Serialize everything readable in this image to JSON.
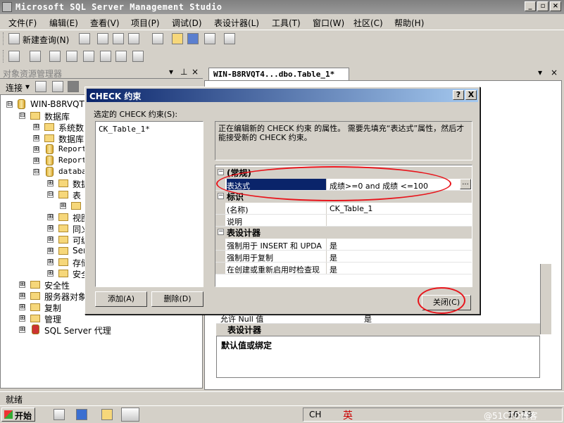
{
  "app": {
    "title": "Microsoft SQL Server Management Studio"
  },
  "menu": [
    "文件(F)",
    "编辑(E)",
    "查看(V)",
    "项目(P)",
    "调试(D)",
    "表设计器(L)",
    "工具(T)",
    "窗口(W)",
    "社区(C)",
    "帮助(H)"
  ],
  "toolbar": {
    "new_query": "新建查询(N)"
  },
  "object_explorer": {
    "title": "对象资源管理器",
    "connect": "连接",
    "tree": [
      {
        "label": "WIN-B8RVQT412",
        "toggle": "⊟"
      },
      {
        "label": "数据库",
        "toggle": "⊟"
      },
      {
        "label": "系统数",
        "toggle": "⊞"
      },
      {
        "label": "数据库",
        "toggle": "⊞"
      },
      {
        "label": "Report",
        "toggle": "⊞"
      },
      {
        "label": "Report",
        "toggle": "⊞"
      },
      {
        "label": "databa",
        "toggle": "⊟"
      },
      {
        "label": "数据",
        "toggle": "⊞"
      },
      {
        "label": "表",
        "toggle": "⊟"
      },
      {
        "label": "",
        "toggle": "⊞"
      },
      {
        "label": "视图",
        "toggle": "⊞"
      },
      {
        "label": "同义",
        "toggle": "⊞"
      },
      {
        "label": "可编",
        "toggle": "⊞"
      },
      {
        "label": "Ser",
        "toggle": "⊞"
      },
      {
        "label": "存储",
        "toggle": "⊞"
      },
      {
        "label": "安全",
        "toggle": "⊞"
      },
      {
        "label": "安全性",
        "toggle": "⊞"
      },
      {
        "label": "服务器对象",
        "toggle": "⊞"
      },
      {
        "label": "复制",
        "toggle": "⊞"
      },
      {
        "label": "管理",
        "toggle": "⊞"
      },
      {
        "label": "SQL Server 代理",
        "toggle": "⊞"
      }
    ]
  },
  "document": {
    "tab": "WIN-B8RVQT4...dbo.Table_1*",
    "bottom_category": "表设计器",
    "bottom_row_name": "允许 Null 值",
    "bottom_row_value": "是",
    "default_binding": "默认值或绑定"
  },
  "dialog": {
    "title": "CHECK 约束",
    "help_btn": "?",
    "close_btn": "X",
    "selected_label": "选定的 CHECK 约束(S):",
    "selected_item": "CK_Table_1*",
    "description": "正在编辑新的 CHECK 约束 的属性。 需要先填充“表达式”属性，然后才能接受新的 CHECK 约束。",
    "add_button": "添加(A)",
    "delete_button": "删除(D)",
    "close_button": "关闭(C)",
    "grid": {
      "cat_general": "(常规)",
      "expression_name": "表达式",
      "expression_value": "成绩>=0 and 成绩 <=100",
      "cat_identity": "标识",
      "name_name": "(名称)",
      "name_value": "CK_Table_1",
      "description_name": "说明",
      "description_value": "",
      "cat_designer": "表设计器",
      "enforce_insert_name": "强制用于 INSERT 和 UPDA",
      "enforce_insert_value": "是",
      "enforce_replication_name": "强制用于复制",
      "enforce_replication_value": "是",
      "check_existing_name": "在创建或重新启用时检查现",
      "check_existing_value": "是"
    }
  },
  "status": {
    "text": "就绪"
  },
  "taskbar": {
    "start": "开始",
    "ime": "CH",
    "ime_mode": "英",
    "clock": "16:19",
    "watermark": "@51CTO博客"
  },
  "colors": {
    "title_active": "#0a246a",
    "annotation": "#e8141b"
  }
}
